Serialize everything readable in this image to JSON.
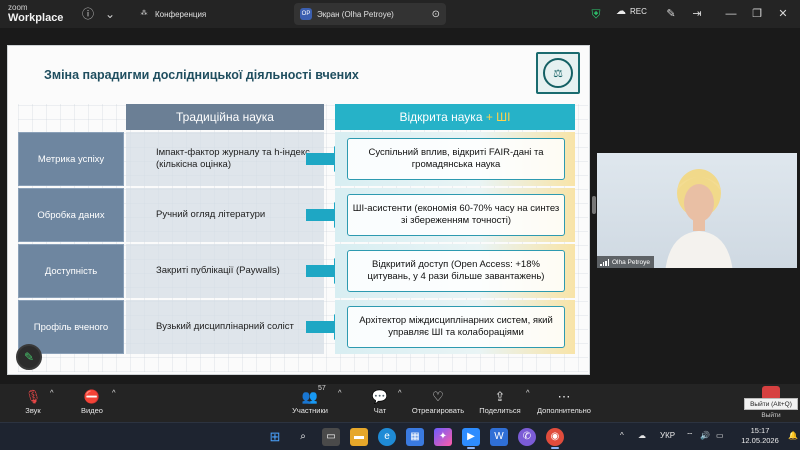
{
  "titlebar": {
    "logo_line1": "zoom",
    "logo_line2": "Workplace",
    "tab_conference": "Конференция",
    "tab_screen": "Экран (Olha Petroye)",
    "tab_screen_initials": "OP",
    "rec_label": "REC"
  },
  "slide": {
    "title": "Зміна парадигми дослідницької діяльності вчених",
    "header_traditional": "Традиційна наука",
    "header_open_a": "Відкрита наука ",
    "header_open_plus": "+ ШІ",
    "rows": [
      {
        "label": "Метрика успіху",
        "traditional": "Імпакт-фактор журналу та h-індекс (кількісна оцінка)",
        "open": "Суспільний вплив, відкриті FAIR-дані та громадянська наука"
      },
      {
        "label": "Обробка даних",
        "traditional": "Ручний огляд літератури",
        "open": "ШІ-асистенти (економія 60-70% часу на синтез зі збереженням точності)"
      },
      {
        "label": "Доступність",
        "traditional": "Закриті публікації (Paywalls)",
        "open": "Відкритий доступ (Open Access: +18% цитувань, у 4 рази більше завантажень)"
      },
      {
        "label": "Профіль вченого",
        "traditional": "Вузький дисциплінарний соліст",
        "open": "Архітектор міждисциплінарних систем, який управляє ШІ та колабораціями"
      }
    ]
  },
  "video": {
    "name": "Olha Petroye"
  },
  "toolbar": {
    "audio": "Звук",
    "video": "Видео",
    "participants": "Участники",
    "participants_count": "57",
    "chat": "Чат",
    "react": "Отреагировать",
    "share": "Поделиться",
    "more": "Дополнительно",
    "leave_tooltip": "Выйти (Alt+Q)",
    "leave": "Выйти"
  },
  "taskbar": {
    "lang": "УКР",
    "time": "15:17",
    "date": "12.05.2026"
  },
  "colors": {
    "accent_teal": "#26b2c8",
    "trad_header": "#6b7f95",
    "title_color": "#1f4e5f",
    "leave_red": "#d64040"
  }
}
